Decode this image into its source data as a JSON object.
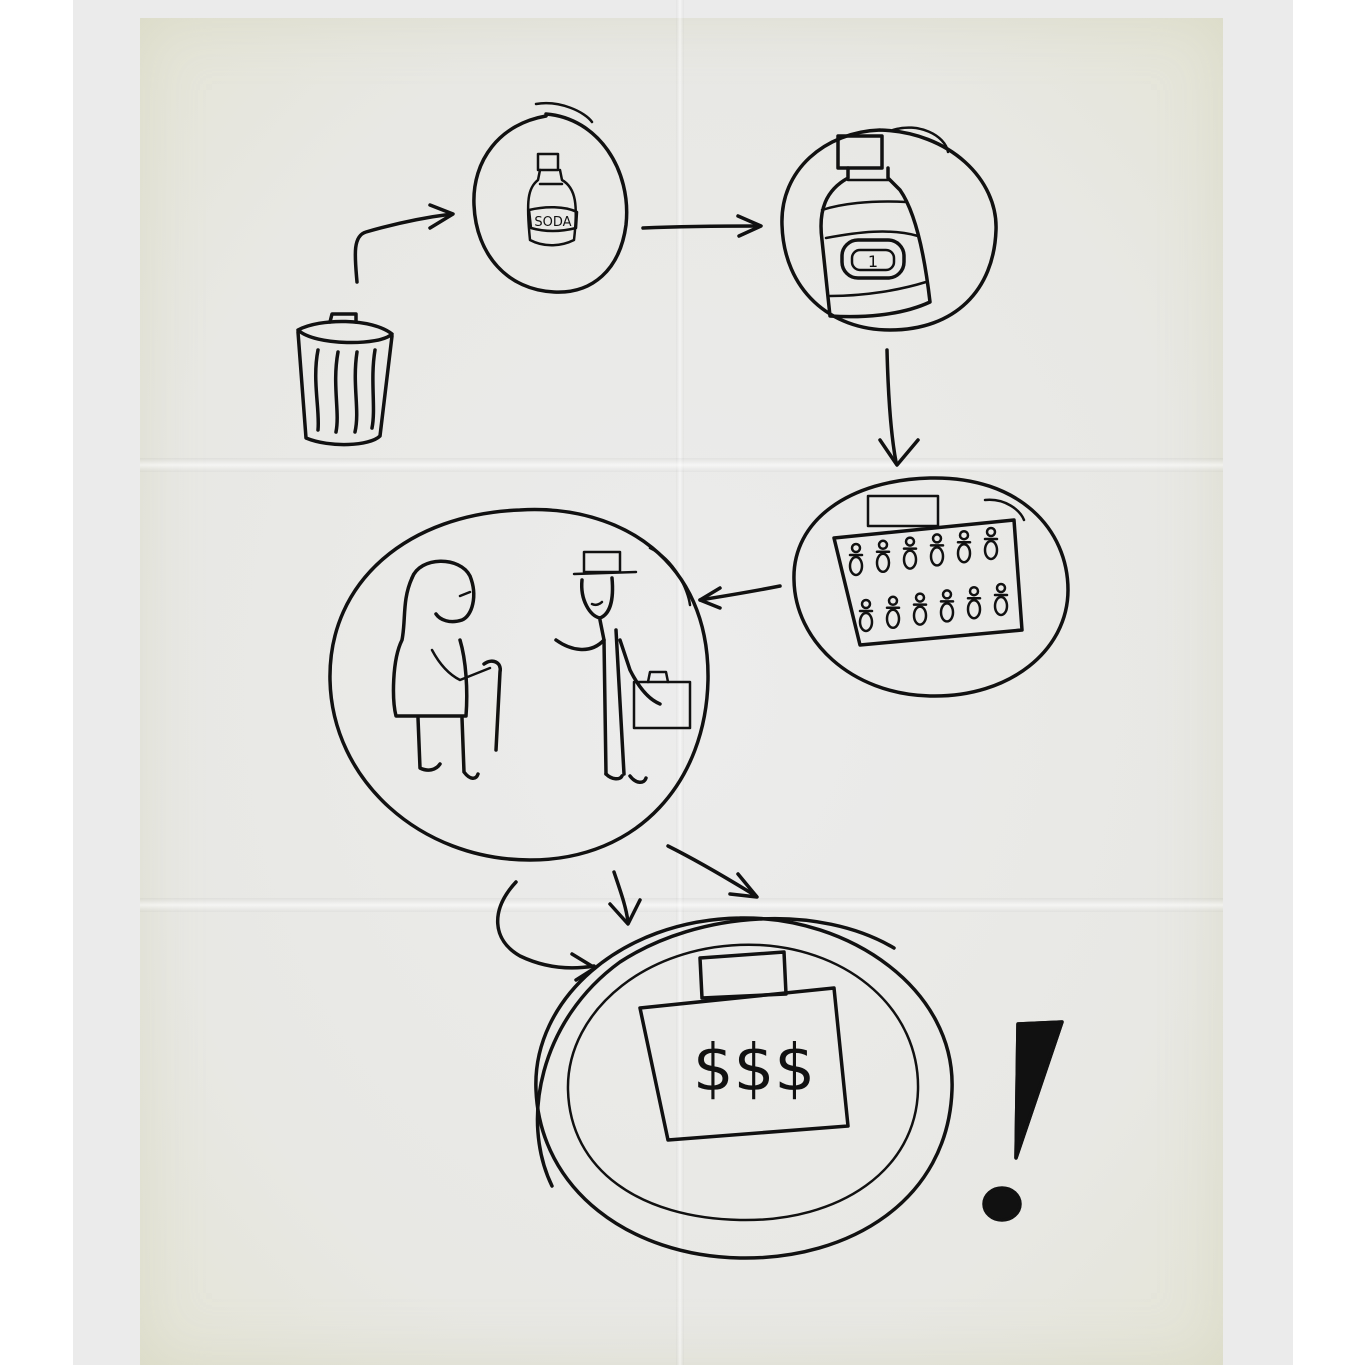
{
  "soda_label": "SODA",
  "bottle_label": "1",
  "money_label": "$$$",
  "exclamation": "!"
}
